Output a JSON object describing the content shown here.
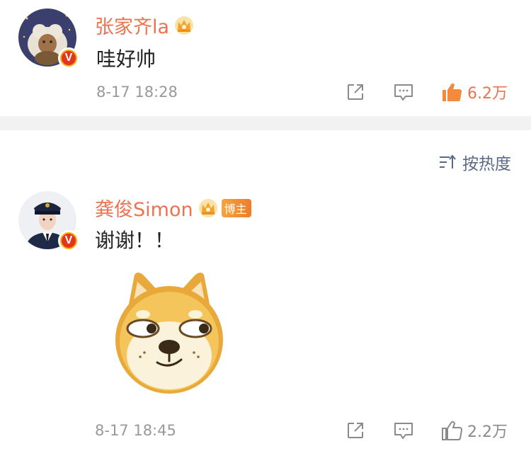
{
  "comments": [
    {
      "username": "张家齐la",
      "text": "哇好帅",
      "time": "8-17 18:28",
      "likes": "6.2万",
      "liked": true
    },
    {
      "username": "龚俊Simon",
      "tag": "博主",
      "text": "谢谢！！",
      "time": "8-17 18:45",
      "likes": "2.2万",
      "liked": false
    }
  ],
  "sort": {
    "label": "按热度"
  },
  "colors": {
    "name": "#eb7350",
    "liked": "#eb7350",
    "muted": "#999999",
    "divider": "#f2f2f2"
  },
  "icons": [
    "crown-icon",
    "verified-badge-icon",
    "share-icon",
    "comment-icon",
    "thumbs-up-icon",
    "sort-icon",
    "doge-emoji"
  ]
}
